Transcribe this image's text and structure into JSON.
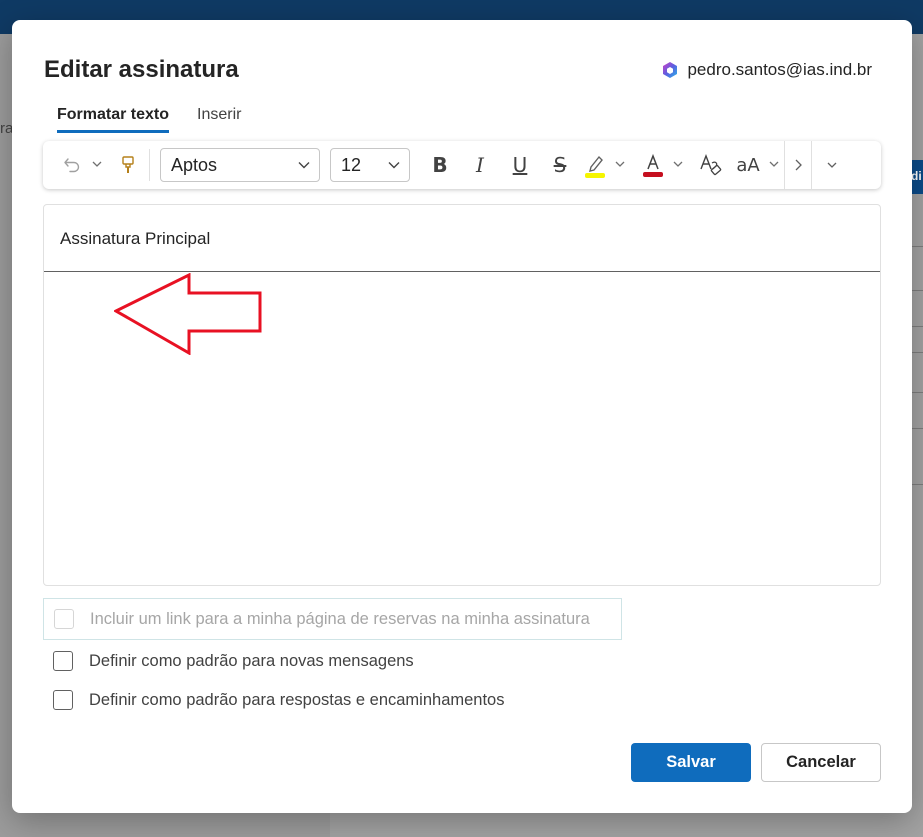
{
  "background": {
    "fragment_text": "ra",
    "side_button_label": "di"
  },
  "dialog": {
    "title": "Editar assinatura",
    "account_email": "pedro.santos@ias.ind.br",
    "tabs": [
      {
        "label": "Formatar texto",
        "active": true
      },
      {
        "label": "Inserir",
        "active": false
      }
    ]
  },
  "toolbar": {
    "font_family": "Aptos",
    "font_size": "12",
    "items": [
      "undo-icon",
      "format-painter-icon",
      "bold-icon",
      "italic-icon",
      "underline-icon",
      "strikethrough-icon",
      "highlight-icon",
      "font-color-icon",
      "clear-formatting-icon",
      "change-case-icon",
      "more-icon"
    ],
    "highlight_color": "#f5f500",
    "font_color": "#c50f1f"
  },
  "editor": {
    "signature_name": "Assinatura Principal",
    "body_text": "",
    "annotation_color": "#e81123"
  },
  "options": {
    "booking_link": {
      "label": "Incluir um link para a minha página de reservas na minha assinatura",
      "checked": false,
      "disabled": true
    },
    "default_new": {
      "label": "Definir como padrão para novas mensagens",
      "checked": false
    },
    "default_replies": {
      "label": "Definir como padrão para respostas e encaminhamentos",
      "checked": false
    }
  },
  "buttons": {
    "save": "Salvar",
    "cancel": "Cancelar"
  },
  "colors": {
    "accent": "#0f6cbd",
    "app_header": "#0f3a64"
  }
}
